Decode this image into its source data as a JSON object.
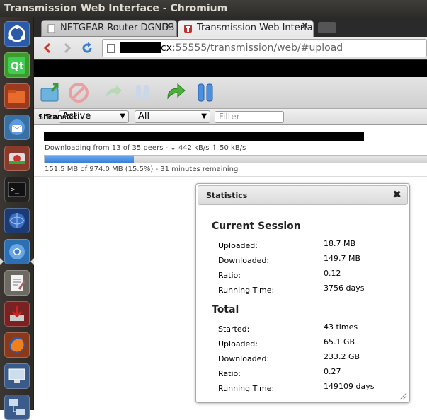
{
  "window": {
    "title": "Transmission Web Interface - Chromium"
  },
  "browser": {
    "tabs": [
      {
        "label": "NETGEAR Router DGND3",
        "active": false
      },
      {
        "label": "Transmission Web Interfa",
        "active": true
      }
    ],
    "tab_close": "×",
    "url": {
      "host_suffix": "cx",
      "rest": ":55555/transmission/web/#upload"
    }
  },
  "filter": {
    "show_label": "Show",
    "state_selected": "Active",
    "tracker_selected": "All",
    "search_placeholder": "Filter",
    "transfer_count": "1 Transfer"
  },
  "torrent": {
    "peers_line": "Downloading from 13 of 35 peers - ↓ 442 kB/s ↑ 50 kB/s",
    "progress_line": "151.5 MB of 974.0 MB (15.5%) - 31 minutes remaining",
    "progress_fraction": 0.155,
    "progress_color": "#3b7fd8"
  },
  "stats": {
    "title": "Statistics",
    "close": "✖",
    "current": {
      "title": "Current Session",
      "rows": [
        {
          "label": "Uploaded:",
          "value": "18.7 MB"
        },
        {
          "label": "Downloaded:",
          "value": "149.7 MB"
        },
        {
          "label": "Ratio:",
          "value": "0.12"
        },
        {
          "label": "Running Time:",
          "value": "3756 days"
        }
      ]
    },
    "total": {
      "title": "Total",
      "rows": [
        {
          "label": "Started:",
          "value": "43 times"
        },
        {
          "label": "Uploaded:",
          "value": "65.1 GB"
        },
        {
          "label": "Downloaded:",
          "value": "233.2 GB"
        },
        {
          "label": "Ratio:",
          "value": "0.27"
        },
        {
          "label": "Running Time:",
          "value": "149109 days"
        }
      ]
    }
  },
  "icons": {
    "launcher": [
      "ubuntu-dash-icon",
      "qt-creator-icon",
      "files-icon",
      "thunderbird-icon",
      "disk-usage-icon",
      "terminal-icon",
      "ubuntu-one-icon",
      "chromium-icon",
      "text-editor-icon",
      "update-manager-icon",
      "firefox-icon",
      "remote-desktop-icon",
      "network-icon"
    ],
    "toolbar": [
      "open-torrent-icon",
      "remove-torrent-icon",
      "resume-icon",
      "pause-icon",
      "resume-all-icon",
      "pause-all-icon"
    ]
  }
}
